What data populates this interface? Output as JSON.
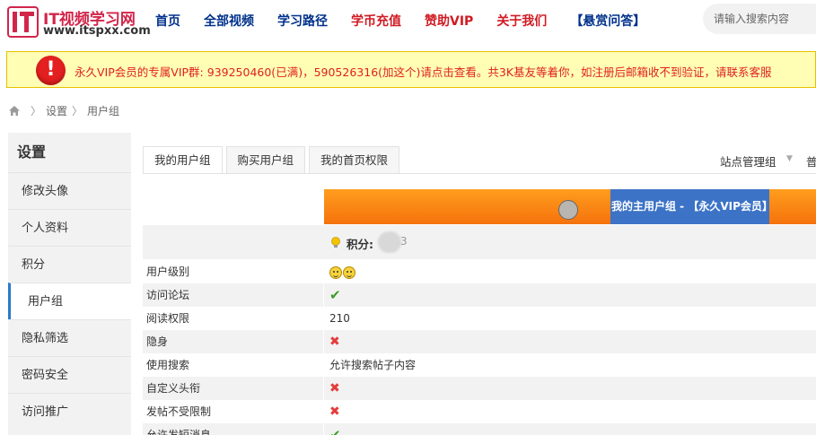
{
  "header": {
    "logo_text": "IT视频学习网",
    "logo_url": "www.itspxx.com",
    "nav": [
      {
        "label": "首页",
        "color": "#00318b"
      },
      {
        "label": "全部视频",
        "color": "#00318b"
      },
      {
        "label": "学习路径",
        "color": "#00318b"
      },
      {
        "label": "学币充值",
        "color": "#d01b23"
      },
      {
        "label": "赞助VIP",
        "color": "#d01b23"
      },
      {
        "label": "关于我们",
        "color": "#d01b23"
      },
      {
        "label": "【悬赏问答】",
        "color": "#00318b"
      }
    ],
    "search_placeholder": "请输入搜索内容"
  },
  "notice": {
    "icon": "exclamation-icon",
    "text": "永久VIP会员的专属VIP群: 939250460(已满)，590526316(加这个)请点击查看。共3K基友等着你，如注册后邮箱收不到验证，请联系客服"
  },
  "breadcrumb": {
    "home_icon": "home-icon",
    "items": [
      "设置",
      "用户组"
    ]
  },
  "sidebar": {
    "title": "设置",
    "items": [
      "修改头像",
      "个人资料",
      "积分",
      "用户组",
      "隐私筛选",
      "密码安全",
      "访问推广"
    ],
    "active": "用户组",
    "accent": "#2b7acb"
  },
  "tabs": {
    "items": [
      "我的用户组",
      "购买用户组",
      "我的首页权限"
    ],
    "active": "我的用户组",
    "admin_link": "站点管理组",
    "more": "普"
  },
  "table": {
    "banner_label": "我的主用户组 - 【永久VIP会员】",
    "banner_color": "#f5720c",
    "points_label": "积分:",
    "points_tail": "3",
    "rows": [
      {
        "label": "用户级别",
        "value": "",
        "icon": "smiley-icon"
      },
      {
        "label": "访问论坛",
        "value": "✔",
        "icon": "check-icon"
      },
      {
        "label": "阅读权限",
        "value": "210",
        "icon": ""
      },
      {
        "label": "隐身",
        "value": "✖",
        "icon": "cross-icon"
      },
      {
        "label": "使用搜索",
        "value": "允许搜索帖子内容",
        "icon": ""
      },
      {
        "label": "自定义头衔",
        "value": "✖",
        "icon": "cross-icon"
      },
      {
        "label": "发帖不受限制",
        "value": "✖",
        "icon": "cross-icon"
      },
      {
        "label": "允许发短消息",
        "value": "✔",
        "icon": "check-icon"
      }
    ]
  }
}
